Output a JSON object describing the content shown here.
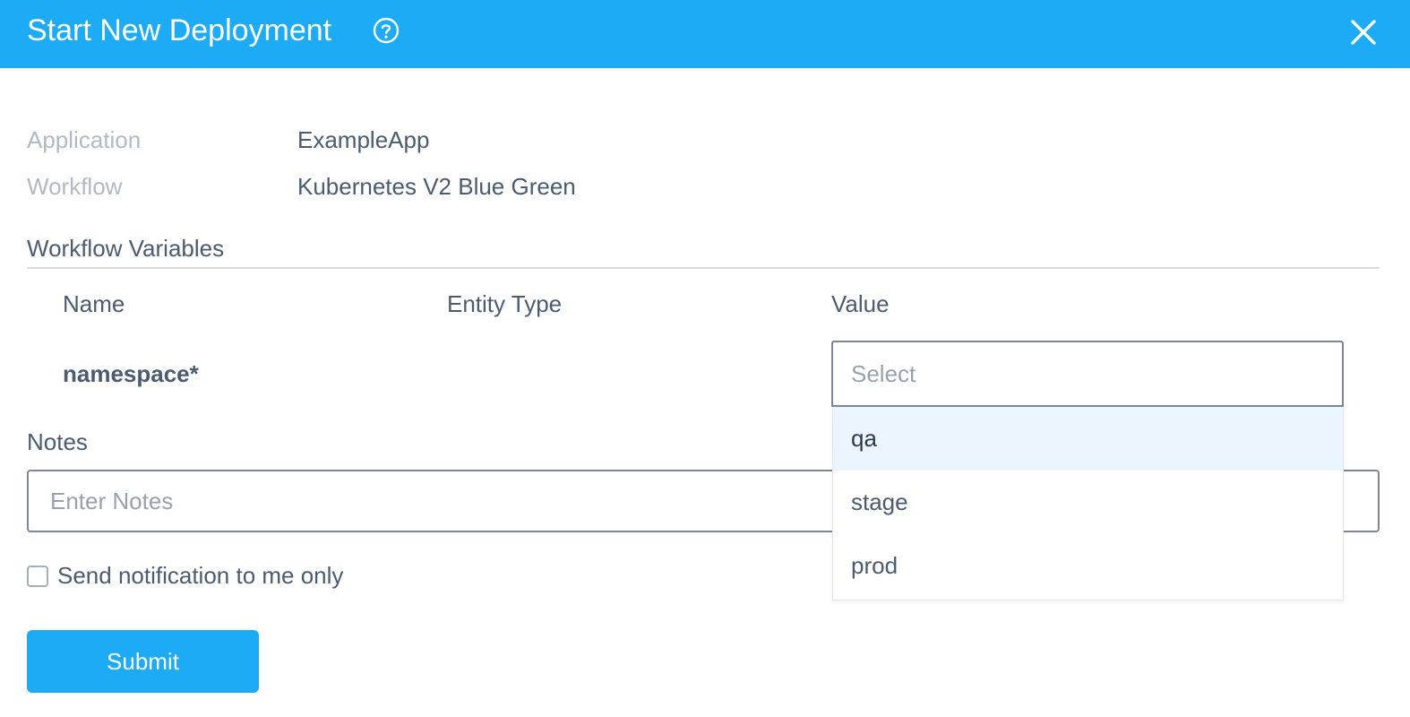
{
  "header": {
    "title": "Start New Deployment",
    "help_icon": "question-circle-icon",
    "close_icon": "close-x-icon",
    "background_color": "#1cabf4"
  },
  "info": {
    "application_label": "Application",
    "application_value": "ExampleApp",
    "workflow_label": "Workflow",
    "workflow_value": "Kubernetes V2 Blue Green"
  },
  "workflow_variables": {
    "section_title": "Workflow Variables",
    "columns": [
      "Name",
      "Entity Type",
      "Value"
    ],
    "rows": [
      {
        "name": "namespace*",
        "entity_type": "",
        "value_placeholder": "Select"
      }
    ],
    "dropdown": {
      "options": [
        "qa",
        "stage",
        "prod"
      ],
      "highlighted": "qa"
    }
  },
  "notes": {
    "label": "Notes",
    "placeholder": "Enter Notes",
    "value": ""
  },
  "notification": {
    "label": "Send notification to me only",
    "checked": false
  },
  "actions": {
    "submit_label": "Submit"
  },
  "colors": {
    "accent": "#1cabf4",
    "text": "#4b5b70",
    "muted": "#b1b9c4",
    "option_highlight": "#eaf5fe"
  }
}
